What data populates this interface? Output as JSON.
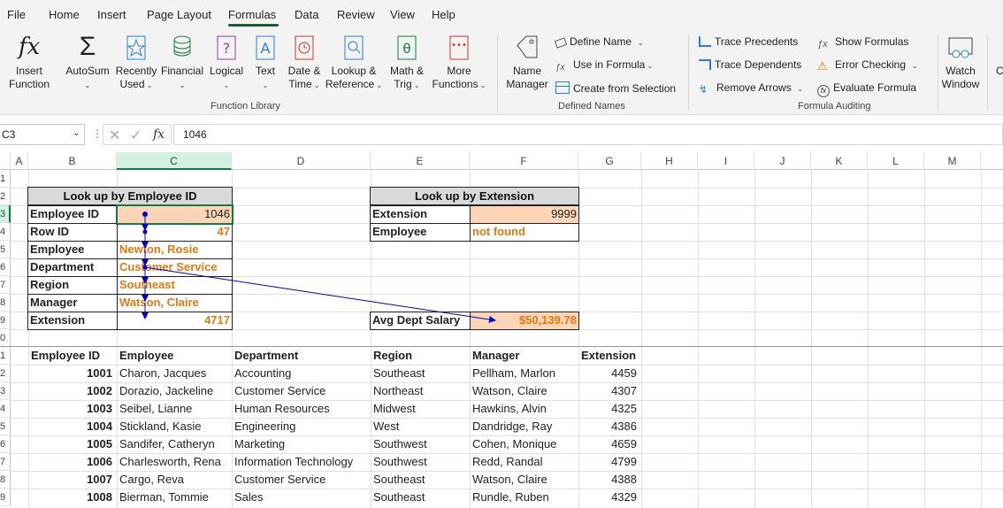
{
  "menu": [
    "File",
    "Home",
    "Insert",
    "Page Layout",
    "Formulas",
    "Data",
    "Review",
    "View",
    "Help"
  ],
  "ribbon": {
    "function_library": {
      "label": "Function Library",
      "insert_function": [
        "Insert",
        "Function"
      ],
      "autosum": "AutoSum",
      "recently_used": [
        "Recently",
        "Used"
      ],
      "financial": "Financial",
      "logical": "Logical",
      "text": "Text",
      "date_time": [
        "Date &",
        "Time"
      ],
      "lookup_reference": [
        "Lookup &",
        "Reference"
      ],
      "math_trig": [
        "Math &",
        "Trig"
      ],
      "more_functions": [
        "More",
        "Functions"
      ]
    },
    "defined_names": {
      "label": "Defined Names",
      "name_manager": [
        "Name",
        "Manager"
      ],
      "define_name": "Define Name",
      "use_in_formula": "Use in Formula",
      "create_from_selection": "Create from Selection"
    },
    "formula_auditing": {
      "label": "Formula Auditing",
      "trace_precedents": "Trace Precedents",
      "trace_dependents": "Trace Dependents",
      "remove_arrows": "Remove Arrows",
      "show_formulas": "Show Formulas",
      "error_checking": "Error Checking",
      "evaluate_formula": "Evaluate Formula",
      "watch_window": [
        "Watch",
        "Window"
      ]
    },
    "cut_off_letter": "C"
  },
  "formula_bar": {
    "name_box": "C3",
    "value": "1046"
  },
  "columns": [
    "A",
    "B",
    "C",
    "D",
    "E",
    "F",
    "G",
    "H",
    "I",
    "J",
    "K",
    "L",
    "M"
  ],
  "rows": [
    "1",
    "2",
    "3",
    "4",
    "5",
    "6",
    "7",
    "8",
    "9",
    "0",
    "1",
    "2",
    "3",
    "4",
    "5",
    "6",
    "7",
    "8",
    "9"
  ],
  "lookup_id": {
    "title": "Look up by Employee ID",
    "labels": [
      "Employee ID",
      "Row ID",
      "Employee",
      "Department",
      "Region",
      "Manager",
      "Extension"
    ],
    "values": [
      "1046",
      "47",
      "Newton, Rosie",
      "Customer Service",
      "Southeast",
      "Watson, Claire",
      "4717"
    ]
  },
  "lookup_ext": {
    "title": "Look up by Extension",
    "labels": [
      "Extension",
      "Employee"
    ],
    "values": [
      "9999",
      "not found"
    ]
  },
  "avg": {
    "label": "Avg Dept Salary",
    "value": "$50,139.78"
  },
  "table": {
    "headers": [
      "Employee ID",
      "Employee",
      "Department",
      "Region",
      "Manager",
      "Extension"
    ],
    "rows": [
      [
        "1001",
        "Charon, Jacques",
        "Accounting",
        "Southeast",
        "Pellham, Marlon",
        "4459"
      ],
      [
        "1002",
        "Dorazio, Jackeline",
        "Customer Service",
        "Northeast",
        "Watson, Claire",
        "4307"
      ],
      [
        "1003",
        "Seibel, Lianne",
        "Human Resources",
        "Midwest",
        "Hawkins, Alvin",
        "4325"
      ],
      [
        "1004",
        "Stickland, Kasie",
        "Engineering",
        "West",
        "Dandridge, Ray",
        "4386"
      ],
      [
        "1005",
        "Sandifer, Catheryn",
        "Marketing",
        "Southwest",
        "Cohen, Monique",
        "4659"
      ],
      [
        "1006",
        "Charlesworth, Rena",
        "Information Technology",
        "Southwest",
        "Redd, Randal",
        "4799"
      ],
      [
        "1007",
        "Cargo, Reva",
        "Customer Service",
        "Southeast",
        "Watson, Claire",
        "4388"
      ],
      [
        "1008",
        "Bierman, Tommie",
        "Sales",
        "Southeast",
        "Rundle, Ruben",
        "4329"
      ]
    ]
  },
  "colors": {
    "accent": "#107c41",
    "highlight": "#fbd5b5",
    "orange": "#e07a10",
    "arrow": "#0000cc"
  }
}
